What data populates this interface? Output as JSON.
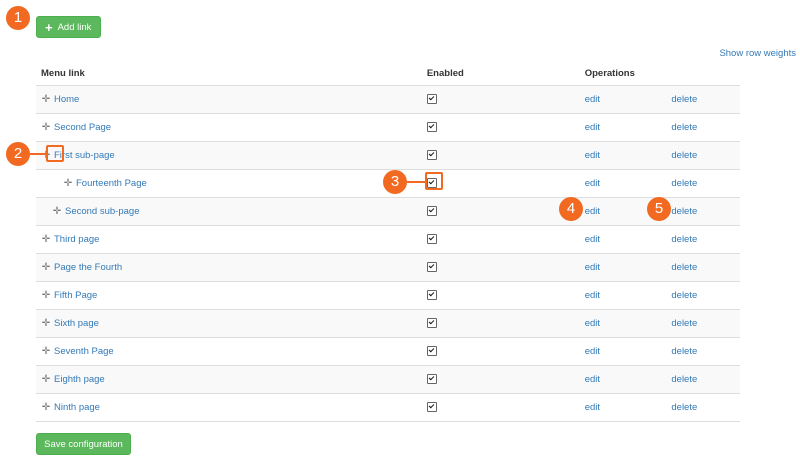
{
  "buttons": {
    "add_link_label": "Add link",
    "save_label": "Save configuration"
  },
  "links": {
    "show_row_weights": "Show row weights"
  },
  "table": {
    "headers": [
      "Menu link",
      "Enabled",
      "Operations"
    ],
    "rows": [
      {
        "title": "Home",
        "depth": 0,
        "enabled": true,
        "edit": "edit",
        "delete": "delete"
      },
      {
        "title": "Second Page",
        "depth": 0,
        "enabled": true,
        "edit": "edit",
        "delete": "delete"
      },
      {
        "title": "First sub-page",
        "depth": 0,
        "enabled": true,
        "edit": "edit",
        "delete": "delete"
      },
      {
        "title": "Fourteenth Page",
        "depth": 2,
        "enabled": true,
        "edit": "edit",
        "delete": "delete"
      },
      {
        "title": "Second sub-page",
        "depth": 1,
        "enabled": true,
        "edit": "edit",
        "delete": "delete"
      },
      {
        "title": "Third page",
        "depth": 0,
        "enabled": true,
        "edit": "edit",
        "delete": "delete"
      },
      {
        "title": "Page the Fourth",
        "depth": 0,
        "enabled": true,
        "edit": "edit",
        "delete": "delete"
      },
      {
        "title": "Fifth Page",
        "depth": 0,
        "enabled": true,
        "edit": "edit",
        "delete": "delete"
      },
      {
        "title": "Sixth page",
        "depth": 0,
        "enabled": true,
        "edit": "edit",
        "delete": "delete"
      },
      {
        "title": "Seventh Page",
        "depth": 0,
        "enabled": true,
        "edit": "edit",
        "delete": "delete"
      },
      {
        "title": "Eighth page",
        "depth": 0,
        "enabled": true,
        "edit": "edit",
        "delete": "delete"
      },
      {
        "title": "Ninth page",
        "depth": 0,
        "enabled": true,
        "edit": "edit",
        "delete": "delete"
      }
    ]
  },
  "callouts": [
    "1",
    "2",
    "3",
    "4",
    "5"
  ],
  "colors": {
    "accent": "#f26a21",
    "button_green": "#5cb85c",
    "link_blue": "#337ab7",
    "row_stripe": "#f9f9f9"
  }
}
